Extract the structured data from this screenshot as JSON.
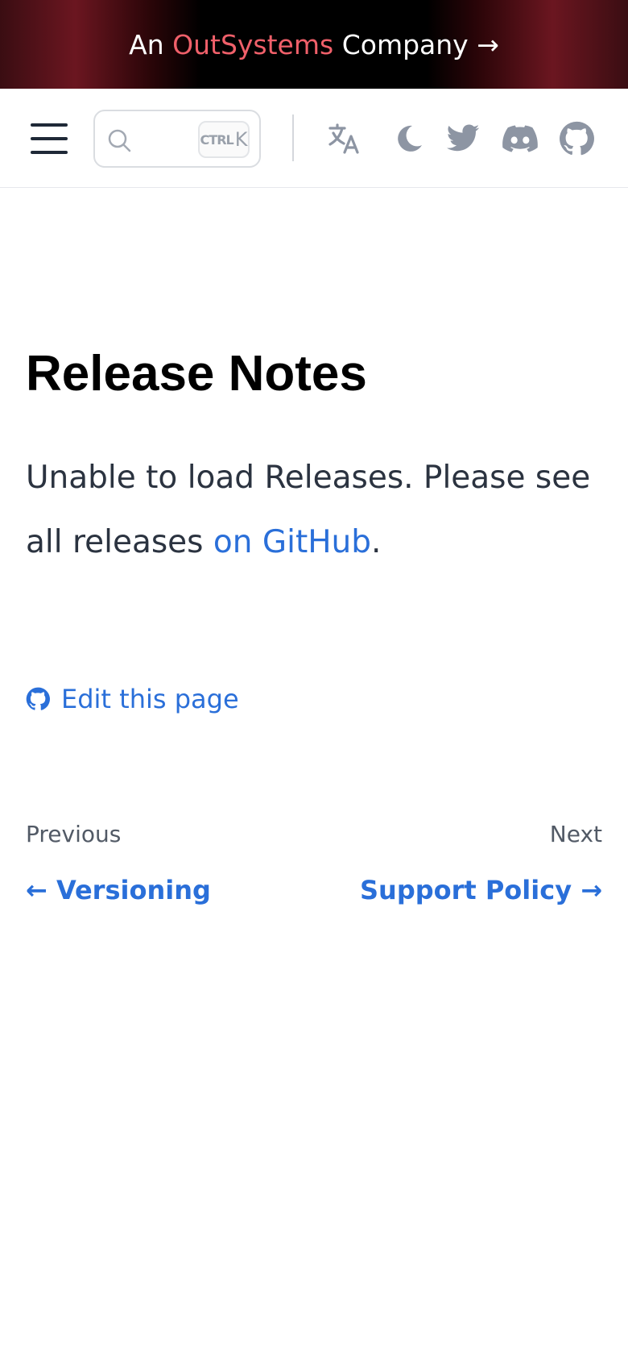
{
  "banner": {
    "prefix": "An ",
    "brand": "OutSystems",
    "suffix": " Company →",
    "colors": {
      "brand": "#f0606a",
      "text": "#ffffff"
    }
  },
  "navbar": {
    "menu_icon": "hamburger-menu-icon",
    "search": {
      "icon": "search-icon",
      "shortcut_ctrl": "CTRL",
      "shortcut_key": "K"
    },
    "icons": [
      "translate-icon",
      "moon-icon",
      "twitter-icon",
      "discord-icon",
      "github-icon"
    ]
  },
  "page": {
    "title": "Release Notes",
    "message_before": "Unable to load Releases. Please see all releases ",
    "message_link": "on GitHub",
    "message_after": ".",
    "edit_link": "Edit this page"
  },
  "pagination": {
    "previous_label": "Previous",
    "previous_title": "← Versioning",
    "next_label": "Next",
    "next_title": "Support Policy →"
  },
  "colors": {
    "link": "#2a6fd9",
    "title": "#000000",
    "body_text": "#2b3340",
    "icon_gray": "#8d95a3"
  }
}
